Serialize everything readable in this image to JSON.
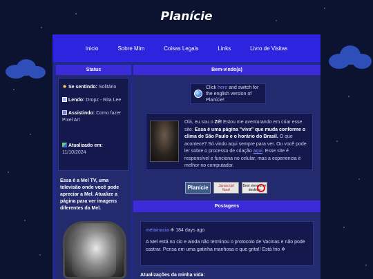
{
  "header": {
    "site_title": "Planície"
  },
  "nav": {
    "items": [
      "Inicio",
      "Sobre Mim",
      "Coisas Legais",
      "Links",
      "Livro de Visitas"
    ]
  },
  "sidebar": {
    "status_title": "Status",
    "feeling_label": "Se sentindo:",
    "feeling_value": "Solitário",
    "reading_label": "Lendo:",
    "reading_value": "Dropz - Rita Lee",
    "watching_label": "Assistindo:",
    "watching_value": "Como fazer Pixel Art",
    "updated_label": "Atualizado em:",
    "updated_value": "11/10/2024",
    "mel_tv_text": "Essa é a Mel TV, uma televisão onde você pode apreciar a Mel. Atualize a página para ver imagens diferentes da Mel."
  },
  "main": {
    "welcome_title": "Bem-vindo(a)",
    "english_prefix": "Click",
    "english_link": "here",
    "english_suffix": "and switch for the english version of Planície!",
    "intro_greeting": "Olá, eu sou o",
    "intro_name": "Zé!",
    "intro_after": "Estou me aventurando em criar esse site.",
    "intro_bold": "Essa é uma página \"viva\" que muda conforme o clima de São Paulo e o horário do Brasil.",
    "intro_rest": "O que acontece? Só vindo aqui sempre para ver. Ou você pode ler sobre o processo de criação",
    "intro_link": "aqui",
    "intro_end": ". Esse site é responsível e funciona no celular, mas a experiencia é melhor no computador.",
    "buttons": [
      "Planície",
      "Javascript Now!",
      "Best viewed on desktop"
    ],
    "postagens_title": "Postagens",
    "post_author": "melainacia",
    "post_time": "184 days ago",
    "post_text": "A Mel está no cio e ainda não terminou o protocolo de Vacinas e não pode castrar. Pensa em uma gatinha manhosa e que grita!! Está frio ❄",
    "updates_label": "Atualizações da minha vida:"
  }
}
